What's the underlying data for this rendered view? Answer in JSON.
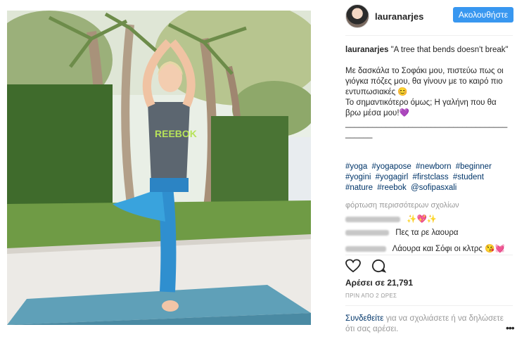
{
  "post": {
    "username": "lauranarjes",
    "follow_label": "Ακολουθήστε",
    "caption": {
      "title": "\"A tree that bends doesn't break\"",
      "line1": "Με δασκάλα το Σοφάκι μου, πιστεύω πως οι γιόγκα πόζες μου, θα γίνουν με το καιρό πιο εντυπωσιακές 😊",
      "line2": "Το σημαντικότερο όμως; Η γαλήνη που θα βρω μέσα μου!💜",
      "separator": "__________________________________________"
    },
    "hashtags": [
      "#yoga",
      "#yogapose",
      "#newborn",
      "#beginner",
      "#yogini",
      "#yogagirl",
      "#firstclass",
      "#student",
      "#nature",
      "#reebok",
      "@sofipasxali"
    ],
    "load_more": "φόρτωση περισσότερων σχολίων",
    "comments": [
      {
        "text": "✨💖✨"
      },
      {
        "text": "Πες τα ρε λαουρα"
      },
      {
        "text": "Λάουρα και Σόφι οι κλτρς 😘💓"
      }
    ],
    "likes": "Αρέσει σε 21,791",
    "timestamp": "ΠΡΙΝ ΑΠΟ 2 ΩΡΕΣ",
    "login_link": "Συνδεθείτε",
    "login_text": " για να σχολιάσετε ή να δηλώσετε ότι σας αρέσει.",
    "more_label": "•••"
  },
  "colors": {
    "accent": "#3897f0",
    "link": "#003569",
    "muted": "#999999"
  }
}
